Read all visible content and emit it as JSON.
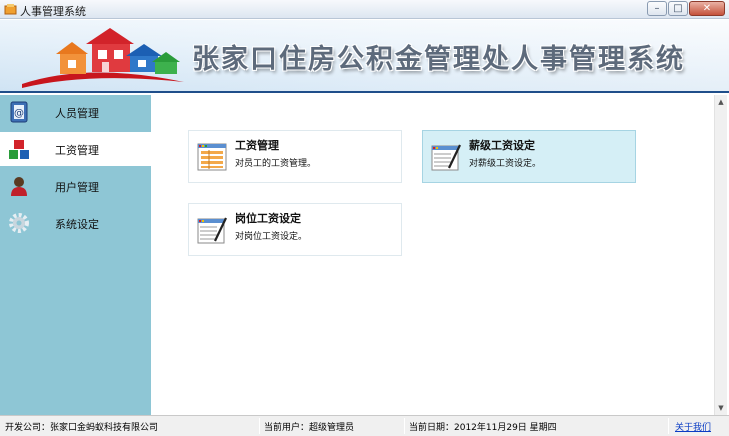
{
  "window": {
    "title": "人事管理系统",
    "app_icon": "app-icon",
    "buttons": [
      {
        "name": "minimize-button",
        "glyph": "–"
      },
      {
        "name": "maximize-button",
        "glyph": "□"
      },
      {
        "name": "close-button",
        "glyph": "✕"
      }
    ]
  },
  "banner": {
    "title": "张家口住房公积金管理处人事管理系统",
    "logo": "houses-logo"
  },
  "sidebar": {
    "items": [
      {
        "label": "人员管理",
        "icon": "contacts-icon",
        "active": false
      },
      {
        "label": "工资管理",
        "icon": "blocks-icon",
        "active": true
      },
      {
        "label": "用户管理",
        "icon": "user-icon",
        "active": false
      },
      {
        "label": "系统设定",
        "icon": "gear-icon",
        "active": false
      }
    ]
  },
  "main": {
    "cards": [
      {
        "title": "工资管理",
        "desc": "对员工的工资管理。",
        "icon": "spreadsheet-icon"
      },
      {
        "title": "薪级工资设定",
        "desc": "对薪级工资设定。",
        "icon": "spreadsheet-pen-icon"
      },
      {
        "title": "岗位工资设定",
        "desc": "对岗位工资设定。",
        "icon": "spreadsheet-pen-icon"
      }
    ]
  },
  "statusbar": {
    "company": "开发公司：张家口金蚂蚁科技有限公司",
    "user": "当前用户：超级管理员",
    "date": "当前日期：2012年11月29日 星期四",
    "about": "关于我们"
  },
  "colors": {
    "sidebar": "#8ec6d5",
    "card_hover": "#d5eff6",
    "banner_border": "#1f4e8a",
    "link": "#0a3cc4"
  }
}
